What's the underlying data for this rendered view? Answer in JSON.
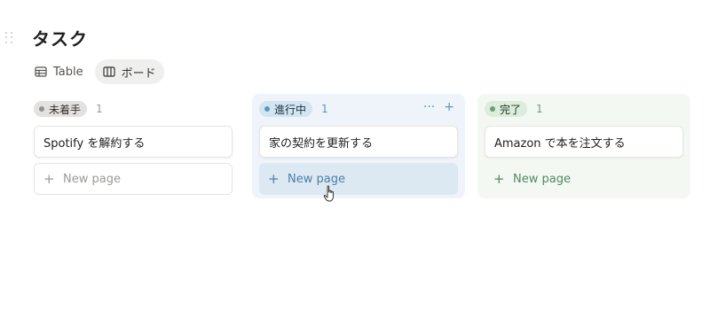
{
  "page": {
    "title": "タスク"
  },
  "views": [
    {
      "label": "Table",
      "icon": "table-icon",
      "active": false
    },
    {
      "label": "ボード",
      "icon": "board-icon",
      "active": true
    }
  ],
  "board": {
    "columns": [
      {
        "status": "未着手",
        "count": "1",
        "color": "#91918e",
        "cards": [
          "Spotify を解約する"
        ],
        "new_page_label": "New page"
      },
      {
        "status": "進行中",
        "count": "1",
        "color": "#5b97bd",
        "cards": [
          "家の契約を更新する"
        ],
        "new_page_label": "New page",
        "actions": [
          "more-icon",
          "plus-icon"
        ]
      },
      {
        "status": "完了",
        "count": "1",
        "color": "#6c9b7d",
        "cards": [
          "Amazon で本を注文する"
        ],
        "new_page_label": "New page"
      }
    ]
  },
  "icons": {
    "more": "···",
    "plus": "+"
  }
}
